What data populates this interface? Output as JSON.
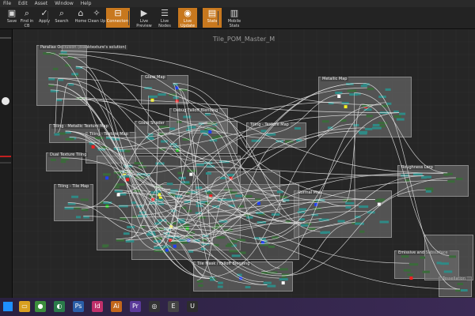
{
  "menu": {
    "items": [
      "File",
      "Edit",
      "Asset",
      "Window",
      "Help"
    ]
  },
  "toolbar": {
    "buttons": [
      {
        "label": "Save",
        "icon": "save-icon",
        "glyph": "▣"
      },
      {
        "label": "Find in CB",
        "icon": "find-icon",
        "glyph": "⌕"
      },
      {
        "label": "Apply",
        "icon": "apply-icon",
        "glyph": "✓"
      },
      {
        "label": "Search",
        "icon": "search-icon",
        "glyph": "⌕"
      },
      {
        "label": "Home",
        "icon": "home-icon",
        "glyph": "⌂"
      },
      {
        "label": "Clean Up",
        "icon": "cleanup-icon",
        "glyph": "✧"
      },
      {
        "label": "Connectors",
        "icon": "connectors-icon",
        "glyph": "⊟",
        "active": true
      },
      {
        "label": "Live Preview",
        "icon": "live-preview-icon",
        "glyph": "▶"
      },
      {
        "label": "Live Nodes",
        "icon": "live-nodes-icon",
        "glyph": "☰"
      },
      {
        "label": "Live Update",
        "icon": "live-update-icon",
        "glyph": "◉",
        "active": true
      },
      {
        "label": "Stats",
        "icon": "stats-icon",
        "glyph": "▤",
        "active": true
      },
      {
        "label": "Mobile Stats",
        "icon": "mobile-stats-icon",
        "glyph": "▥"
      }
    ]
  },
  "graph": {
    "title": "Tile_POM_Master_M"
  },
  "comments": [
    {
      "label": "Parallax Occlusion (Blanktexture's solution)"
    },
    {
      "label": "Glass Map"
    },
    {
      "label": "Metallic Map"
    },
    {
      "label": "Tiling - Metallic Texture Map"
    },
    {
      "label": "Tiling - Texture Map"
    },
    {
      "label": "Glass Shader"
    },
    {
      "label": "Debug Falloff Blending"
    },
    {
      "label": "Tiling - Texture Map"
    },
    {
      "label": "Dual Texture Tiling"
    },
    {
      "label": "Tiling - Tile Map"
    },
    {
      "label": "Roughness Lerp"
    },
    {
      "label": "Normal Map"
    },
    {
      "label": "Emissive and Subsurface"
    },
    {
      "label": "Tile Mask / Falloff Blending"
    },
    {
      "label": "Tessellation"
    }
  ],
  "taskbar": {
    "apps": [
      {
        "name": "windows-start-icon",
        "glyph": "",
        "color": "#1e90ff"
      },
      {
        "name": "file-explorer-icon",
        "glyph": "▭",
        "color": "#d8a020"
      },
      {
        "name": "chrome-icon",
        "glyph": "●",
        "color": "#3c8e3c"
      },
      {
        "name": "app-icon",
        "glyph": "◐",
        "color": "#2a7a4a"
      },
      {
        "name": "photoshop-icon",
        "glyph": "Ps",
        "color": "#2a5ea8"
      },
      {
        "name": "indesign-icon",
        "glyph": "Id",
        "color": "#c0306a"
      },
      {
        "name": "illustrator-icon",
        "glyph": "Ai",
        "color": "#c2661a"
      },
      {
        "name": "premiere-icon",
        "glyph": "Pr",
        "color": "#5b3a9a"
      },
      {
        "name": "app-icon-2",
        "glyph": "◎",
        "color": "#333333"
      },
      {
        "name": "epic-launcher-icon",
        "glyph": "E",
        "color": "#444444"
      },
      {
        "name": "unreal-editor-icon",
        "glyph": "U",
        "color": "#2d2d2d"
      }
    ]
  }
}
